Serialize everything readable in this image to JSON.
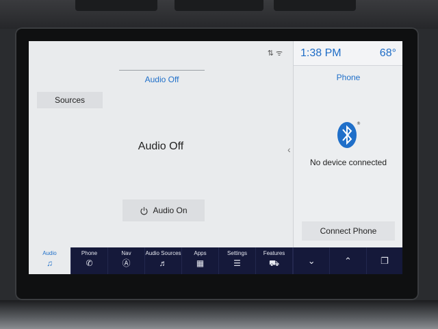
{
  "header": {
    "time": "1:38 PM",
    "temperature": "68°"
  },
  "audio": {
    "source_tab": "Audio Off",
    "sources_label": "Sources",
    "status_text": "Audio Off",
    "audio_on_label": "Audio On"
  },
  "phone": {
    "title": "Phone",
    "status": "No device connected",
    "connect_label": "Connect Phone"
  },
  "nav": [
    {
      "label": "Audio",
      "icon": "music-note-icon"
    },
    {
      "label": "Phone",
      "icon": "phone-handset-icon"
    },
    {
      "label": "Nav",
      "icon": "navigation-arrow-icon"
    },
    {
      "label": "Audio Sources",
      "icon": "audio-sources-icon"
    },
    {
      "label": "Apps",
      "icon": "apps-grid-icon"
    },
    {
      "label": "Settings",
      "icon": "sliders-icon"
    },
    {
      "label": "Features",
      "icon": "truck-icon"
    }
  ],
  "colors": {
    "accent": "#1f6fc9",
    "navbar": "#15193a"
  }
}
